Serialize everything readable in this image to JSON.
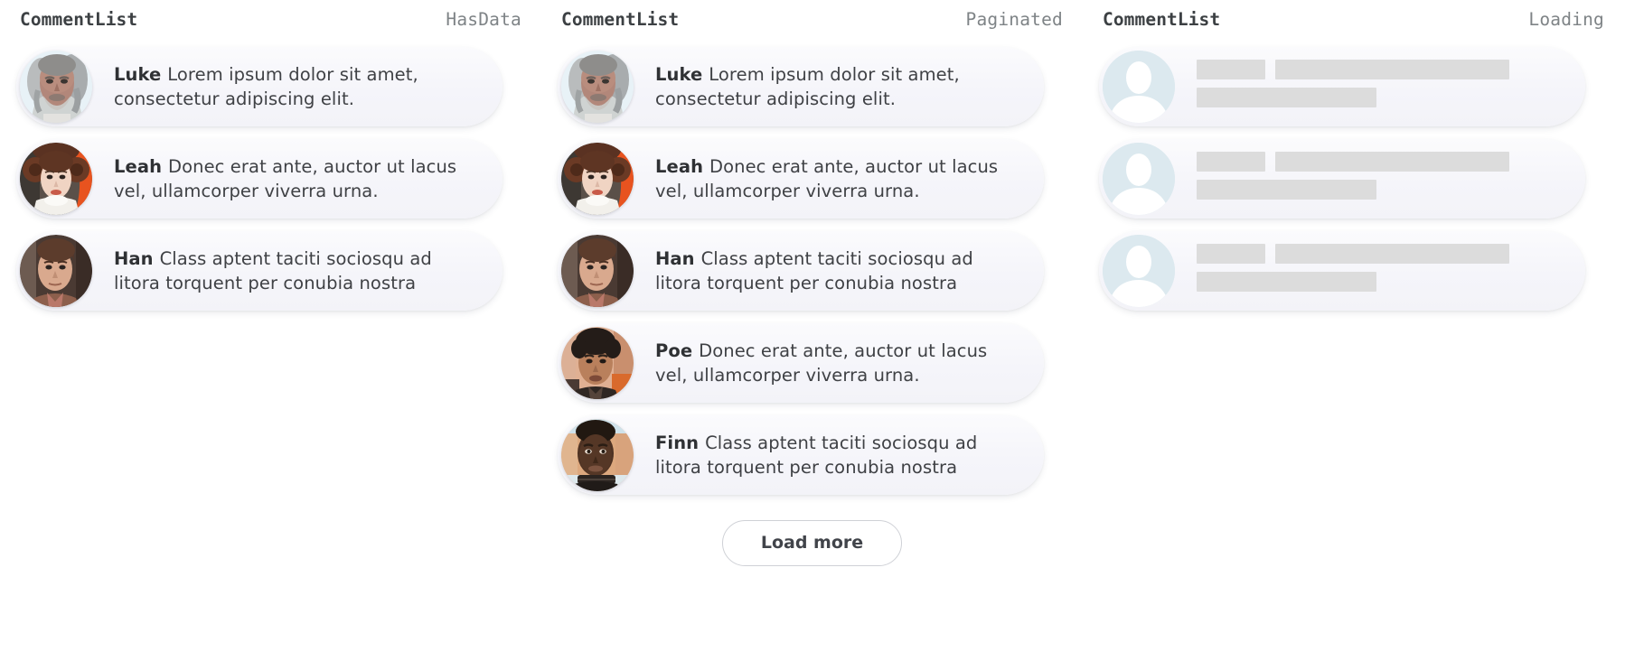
{
  "columns": [
    {
      "title": "CommentList",
      "state": "HasData",
      "comments": [
        {
          "author": "Luke",
          "text": "Lorem ipsum dolor sit amet, consectetur adipiscing elit.",
          "avatar": "luke-avatar"
        },
        {
          "author": "Leah",
          "text": "Donec erat ante, auctor ut lacus vel, ullamcorper viverra urna.",
          "avatar": "leah-avatar"
        },
        {
          "author": "Han",
          "text": "Class aptent taciti sociosqu ad litora torquent per conubia nostra",
          "avatar": "han-avatar"
        }
      ],
      "load_more_label": null
    },
    {
      "title": "CommentList",
      "state": "Paginated",
      "comments": [
        {
          "author": "Luke",
          "text": "Lorem ipsum dolor sit amet, consectetur adipiscing elit.",
          "avatar": "luke-avatar"
        },
        {
          "author": "Leah",
          "text": "Donec erat ante, auctor ut lacus vel, ullamcorper viverra urna.",
          "avatar": "leah-avatar"
        },
        {
          "author": "Han",
          "text": "Class aptent taciti sociosqu ad litora torquent per conubia nostra",
          "avatar": "han-avatar"
        },
        {
          "author": "Poe",
          "text": "Donec erat ante, auctor ut lacus vel, ullamcorper viverra urna.",
          "avatar": "poe-avatar"
        },
        {
          "author": "Finn",
          "text": "Class aptent taciti sociosqu ad litora torquent per conubia nostra",
          "avatar": "finn-avatar"
        }
      ],
      "load_more_label": "Load more"
    },
    {
      "title": "CommentList",
      "state": "Loading",
      "skeleton_count": 3,
      "load_more_label": null
    }
  ],
  "colors": {
    "page_background": "#ffffff",
    "card_background": "#f5f5fa",
    "title_text": "#3c4043",
    "state_text": "#7e8386",
    "body_text": "#3f4145",
    "skeleton_bar": "#dcdcdc",
    "skeleton_avatar": "#dce9ef",
    "button_border": "#cfd1d6"
  }
}
